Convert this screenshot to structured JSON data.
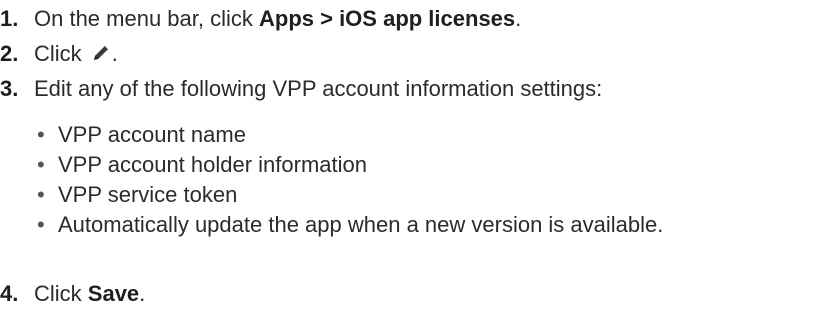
{
  "steps": [
    {
      "number": "1.",
      "text_before": "On the menu bar, click ",
      "bold": "Apps > iOS app licenses",
      "text_after": "."
    },
    {
      "number": "2.",
      "text_before": "Click ",
      "icon": "pencil-edit-icon",
      "text_after": "."
    },
    {
      "number": "3.",
      "text": "Edit any of the following VPP account information settings:",
      "bullets": [
        "VPP account name",
        "VPP account holder information",
        "VPP service token",
        "Automatically update the app when a new version is available."
      ]
    },
    {
      "number": "4.",
      "text_before": "Click ",
      "bold": "Save",
      "text_after": "."
    }
  ],
  "bullet_glyph": "•"
}
